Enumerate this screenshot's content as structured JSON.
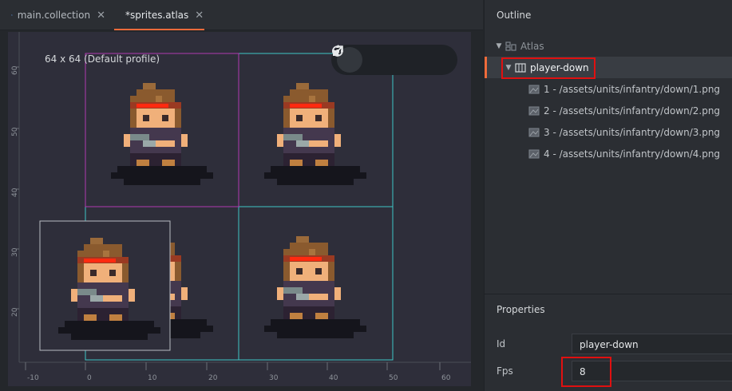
{
  "tabs": [
    {
      "label": "main.collection",
      "icon": "collection-icon"
    },
    {
      "label": "*sprites.atlas",
      "icon": "atlas-icon",
      "active": true
    }
  ],
  "scene": {
    "profile_label": "64 x 64 (Default profile)",
    "ruler_x": [
      "-10",
      "0",
      "10",
      "20",
      "30",
      "40",
      "50",
      "60"
    ],
    "ruler_y": [
      "60",
      "50",
      "40",
      "30",
      "20"
    ],
    "toolbar": [
      "move-tool",
      "rotate-tool",
      "scale-tool",
      "reset-view-tool"
    ]
  },
  "outline": {
    "title": "Outline",
    "root": "Atlas",
    "animation": "player-down",
    "images": [
      "1 - /assets/units/infantry/down/1.png",
      "2 - /assets/units/infantry/down/2.png",
      "3 - /assets/units/infantry/down/3.png",
      "4 - /assets/units/infantry/down/4.png"
    ]
  },
  "properties": {
    "title": "Properties",
    "id_label": "Id",
    "id_value": "player-down",
    "fps_label": "Fps",
    "fps_value": "8"
  },
  "colors": {
    "accent": "#ef6b3b",
    "highlight_box": "#e01010",
    "frame_magenta": "#b03bb0",
    "frame_cyan": "#3fc6c6"
  }
}
